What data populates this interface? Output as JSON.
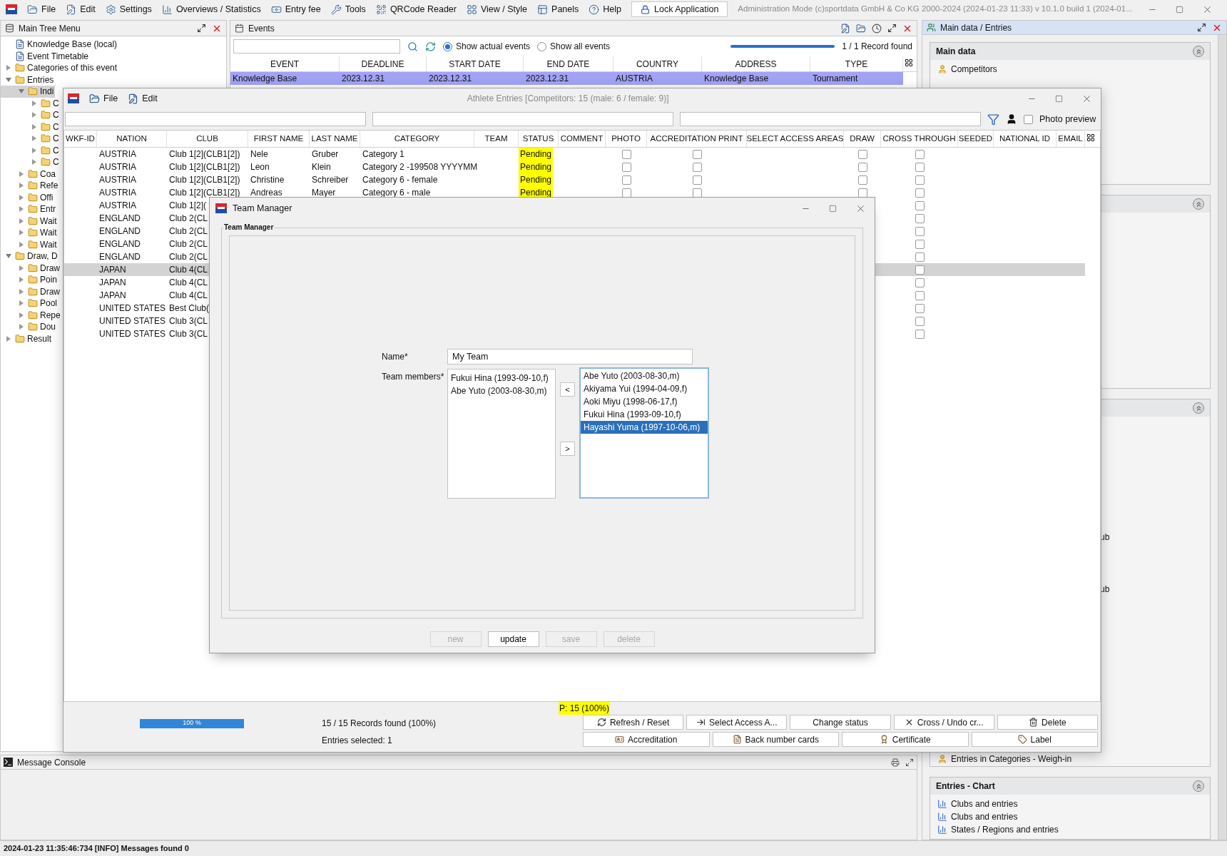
{
  "menu_bar": {
    "items": [
      {
        "label": "File"
      },
      {
        "label": "Edit"
      },
      {
        "label": "Settings"
      },
      {
        "label": "Overviews / Statistics"
      },
      {
        "label": "Entry fee"
      },
      {
        "label": "Tools"
      },
      {
        "label": "QRCode Reader"
      },
      {
        "label": "View / Style"
      },
      {
        "label": "Panels"
      },
      {
        "label": "Help"
      }
    ],
    "lock_button": "Lock Application",
    "title": "Administration Mode (c)sportdata GmbH & Co KG 2000-2024 (2024-01-23 11:33)  v 10.1.0 build 1 (2024-01..."
  },
  "main_tree": {
    "title": "Main Tree Menu",
    "items": [
      {
        "label": "Knowledge Base (local)",
        "selected": false
      },
      {
        "label": "Event Timetable",
        "selected": false
      },
      {
        "label": "Categories of this event",
        "selected": false,
        "expanded": false
      },
      {
        "label": "Entries",
        "selected": false,
        "expanded": true,
        "children": [
          {
            "label": "Indi",
            "selected": true,
            "expanded": true,
            "children": [
              {
                "label": "C",
                "selected": false,
                "expanded": false
              },
              {
                "label": "C",
                "selected": false,
                "expanded": false
              },
              {
                "label": "C",
                "selected": false,
                "expanded": false
              },
              {
                "label": "C",
                "selected": false,
                "expanded": false
              },
              {
                "label": "C",
                "selected": false,
                "expanded": false
              },
              {
                "label": "C",
                "selected": false,
                "expanded": false
              }
            ]
          },
          {
            "label": "Coa",
            "selected": false,
            "expanded": false
          },
          {
            "label": "Refe",
            "selected": false,
            "expanded": false
          },
          {
            "label": "Offi",
            "selected": false,
            "expanded": false
          },
          {
            "label": "Entr",
            "selected": false,
            "expanded": false
          },
          {
            "label": "Wait",
            "selected": false,
            "expanded": false
          },
          {
            "label": "Wait",
            "selected": false,
            "expanded": false
          },
          {
            "label": "Wait",
            "selected": false,
            "expanded": false
          }
        ]
      },
      {
        "label": "Draw, D",
        "selected": false,
        "expanded": true,
        "children": [
          {
            "label": "Draw",
            "selected": false,
            "expanded": false
          },
          {
            "label": "Poin",
            "selected": false,
            "expanded": false
          },
          {
            "label": "Draw",
            "selected": false,
            "expanded": false
          },
          {
            "label": "Pool",
            "selected": false,
            "expanded": false
          },
          {
            "label": "Repe",
            "selected": false,
            "expanded": false
          },
          {
            "label": "Dou",
            "selected": false,
            "expanded": false
          }
        ]
      },
      {
        "label": "Result",
        "selected": false,
        "expanded": false
      }
    ]
  },
  "events": {
    "title": "Events",
    "filter_options": [
      {
        "label": "Show actual events",
        "selected": true
      },
      {
        "label": "Show all events",
        "selected": false
      }
    ],
    "progress": {
      "level": 1
    },
    "record_count": "1 / 1 Record found",
    "columns": [
      "EVENT",
      "DEADLINE",
      "START DATE",
      "END DATE",
      "COUNTRY",
      "ADDRESS",
      "TYPE"
    ],
    "rows": [
      {
        "selected": true,
        "cells": [
          "Knowledge Base",
          "2023.12.31",
          "2023.12.31",
          "2023.12.31",
          "AUSTRIA",
          "Knowledge Base",
          "Tournament"
        ]
      }
    ]
  },
  "right_panel": {
    "title": "Main data / Entries",
    "sections": [
      {
        "title": "Main data",
        "expanded": true,
        "items": [
          "Competitors"
        ]
      },
      {
        "expanded": true
      },
      {
        "expanded": true,
        "items": [
          "ub",
          "ub",
          "Entries in Categories - Weigh-in"
        ]
      },
      {
        "title": "Entries - Chart",
        "expanded": true,
        "items": [
          "Clubs and entries",
          "Clubs and entries",
          "States / Regions and entries"
        ]
      }
    ]
  },
  "message_console": {
    "title": "Message Console"
  },
  "status_bar": "2024-01-23 11:35:46:734 [INFO] Messages found 0",
  "athlete_window": {
    "title": "Athlete Entries [Competitors: 15 (male: 6 / female: 9)]",
    "menu": [
      "File",
      "Edit"
    ],
    "photo_preview": {
      "label": "Photo preview",
      "checked": false
    },
    "columns": [
      "WKF-ID",
      "NATION",
      "CLUB",
      "FIRST NAME",
      "LAST NAME",
      "CATEGORY",
      "TEAM",
      "STATUS",
      "COMMENT",
      "PHOTO",
      "ACCREDITATION PRINT",
      "SELECT ACCESS AREAS",
      "DRAW",
      "CROSS THROUGH",
      "SEEDED",
      "NATIONAL ID",
      "EMAIL"
    ],
    "rows": [
      {
        "selected": false,
        "nation": "AUSTRIA",
        "club": "Club 1[2](CLB1[2])",
        "first_name": "Nele",
        "last_name": "Gruber",
        "category": "Category 1",
        "status": "Pending",
        "photo": false,
        "accreditation_print": false,
        "draw": false,
        "cross_through": false
      },
      {
        "selected": false,
        "nation": "AUSTRIA",
        "club": "Club 1[2](CLB1[2])",
        "first_name": "Leon",
        "last_name": "Klein",
        "category": "Category 2 -199508 YYYYMM",
        "status": "Pending",
        "photo": false,
        "accreditation_print": false,
        "draw": false,
        "cross_through": false
      },
      {
        "selected": false,
        "nation": "AUSTRIA",
        "club": "Club 1[2](CLB1[2])",
        "first_name": "Christine",
        "last_name": "Schreiber",
        "category": "Category 6 - female",
        "status": "Pending",
        "photo": false,
        "accreditation_print": false,
        "draw": false,
        "cross_through": false
      },
      {
        "selected": false,
        "nation": "AUSTRIA",
        "club": "Club 1[2](CLB1[2])",
        "first_name": "Andreas",
        "last_name": "Mayer",
        "category": "Category 6 - male",
        "status": "Pending",
        "photo": false,
        "accreditation_print": false,
        "draw": false,
        "cross_through": false
      },
      {
        "selected": false,
        "nation": "AUSTRIA",
        "club": "Club 1[2](",
        "cross_through": false
      },
      {
        "selected": false,
        "nation": "ENGLAND",
        "club": "Club 2(CL",
        "cross_through": false
      },
      {
        "selected": false,
        "nation": "ENGLAND",
        "club": "Club 2(CL",
        "cross_through": false
      },
      {
        "selected": false,
        "nation": "ENGLAND",
        "club": "Club 2(CL",
        "cross_through": false
      },
      {
        "selected": false,
        "nation": "ENGLAND",
        "club": "Club 2(CL",
        "cross_through": false
      },
      {
        "selected": true,
        "nation": "JAPAN",
        "club": "Club 4(CL",
        "cross_through": false
      },
      {
        "selected": false,
        "nation": "JAPAN",
        "club": "Club 4(CL",
        "cross_through": false
      },
      {
        "selected": false,
        "nation": "JAPAN",
        "club": "Club 4(CL",
        "cross_through": false
      },
      {
        "selected": false,
        "nation": "UNITED STATES",
        "club": "Best Club(",
        "cross_through": false
      },
      {
        "selected": false,
        "nation": "UNITED STATES",
        "club": "Club 3(CL",
        "cross_through": false
      },
      {
        "selected": false,
        "nation": "UNITED STATES",
        "club": "Club 3(CL",
        "cross_through": false
      }
    ],
    "footer": {
      "percent_label": "P: 15 (100%)",
      "progress": {
        "level": 1,
        "label": "100 %"
      },
      "records": "15 / 15 Records found (100%)",
      "entries_selected": "Entries selected: 1",
      "buttons": [
        "Refresh / Reset",
        "Select Access A...",
        "Change status",
        "Cross / Undo cr...",
        "Delete"
      ],
      "buttons_row2": [
        "Accreditation",
        "Back number cards",
        "Certificate",
        "Label"
      ]
    }
  },
  "team_dialog": {
    "title": "Team Manager",
    "group_label": "Team Manager",
    "name_label": "Name*",
    "name_value": "My Team",
    "members_label": "Team members*",
    "members": [
      {
        "label": "Fukui Hina (1993-09-10,f)",
        "selected": false
      },
      {
        "label": "Abe Yuto (2003-08-30,m)",
        "selected": false
      }
    ],
    "move_left": "<",
    "move_right": ">",
    "available": [
      {
        "label": "Abe Yuto (2003-08-30,m)",
        "selected": false
      },
      {
        "label": "Akiyama Yui (1994-04-09,f)",
        "selected": false
      },
      {
        "label": "Aoki Miyu (1998-06-17,f)",
        "selected": false
      },
      {
        "label": "Fukui Hina (1993-09-10,f)",
        "selected": false
      },
      {
        "label": "Hayashi Yuma (1997-10-06,m)",
        "selected": true
      }
    ],
    "buttons": [
      {
        "label": "new",
        "disabled": true
      },
      {
        "label": "update",
        "disabled": false
      },
      {
        "label": "save",
        "disabled": true
      },
      {
        "label": "delete",
        "disabled": true
      }
    ]
  }
}
